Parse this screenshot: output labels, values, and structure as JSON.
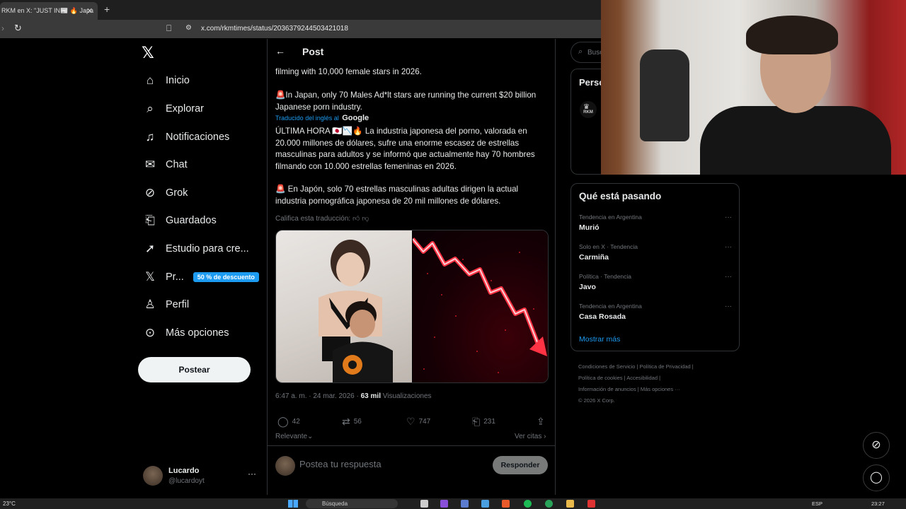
{
  "browser": {
    "tab_title": "RKM en X: \"JUST IN📰 🔥 Japa",
    "tab_close": "✕",
    "new_tab": "+",
    "url": "x.com/rkmtimes/status/2036379244503421018"
  },
  "nav": {
    "items": [
      {
        "label": "Inicio",
        "icon": "home-icon"
      },
      {
        "label": "Explorar",
        "icon": "search-icon"
      },
      {
        "label": "Notificaciones",
        "icon": "bell-icon"
      },
      {
        "label": "Chat",
        "icon": "mail-icon"
      },
      {
        "label": "Grok",
        "icon": "grok-icon"
      },
      {
        "label": "Guardados",
        "icon": "bookmark-icon"
      },
      {
        "label": "Estudio para cre...",
        "icon": "rocket-icon"
      },
      {
        "label": "Pr...",
        "icon": "x-premium-icon"
      },
      {
        "label": "Perfil",
        "icon": "person-icon"
      },
      {
        "label": "Más opciones",
        "icon": "more-circle-icon"
      }
    ],
    "premium_badge": "50 % de descuento",
    "post_button": "Postear"
  },
  "account": {
    "name": "Lucardo",
    "handle": "@lucardoyt",
    "more": "···"
  },
  "post": {
    "header_title": "Post",
    "text_en_1": "filming with 10,000 female stars in 2026.",
    "text_en_2": "🚨In Japan, only 70 Males Ad*lt stars are running the current $20 billion Japanese porn industry.",
    "translated_by": "Traducido del inglés al",
    "translated_brand": "Google",
    "text_es_1": "ÚLTIMA HORA 🇯🇵📉🔥 La industria japonesa del porno, valorada en 20.000 millones de dólares, sufre una enorme escasez de estrellas masculinas para adultos y se informó que actualmente hay 70 hombres filmando con 10.000 estrellas femeninas en 2026.",
    "text_es_2": "🚨 En Japón, solo 70 estrellas masculinas adultas dirigen la actual industria pornográfica japonesa de 20 mil millones de dólares.",
    "rate_translation": "Califica esta traducción:",
    "meta_time": "6:47 a. m. · 24 mar. 2026 · ",
    "meta_views": "63 mil",
    "meta_views_label": " Visualizaciones",
    "replies": "42",
    "reposts": "56",
    "likes": "747",
    "bookmarks": "231",
    "relevant": "Relevante",
    "quotes": "Ver citas",
    "reply_placeholder": "Postea tu respuesta",
    "reply_button": "Responder"
  },
  "sidebar": {
    "search_placeholder": "Busc",
    "persons_title": "Perso",
    "rkm_label": "RKM",
    "trends_title": "Qué está pasando",
    "trends": [
      {
        "context": "Tendencia en Argentina",
        "name": "Murió"
      },
      {
        "context": "Solo en X · Tendencia",
        "name": "Carmiña"
      },
      {
        "context": "Política · Tendencia",
        "name": "Javo"
      },
      {
        "context": "Tendencia en Argentina",
        "name": "Casa Rosada"
      }
    ],
    "trend_more": "···",
    "show_more": "Mostrar más",
    "footer": {
      "l1": "Condiciones de Servicio  |  Política de Privacidad  |",
      "l2": "Política de cookies  |  Accesibilidad  |",
      "l3": "Información de anuncios  |  Más opciones ···",
      "l4": "© 2026 X Corp."
    }
  },
  "taskbar": {
    "weather": "23°C",
    "search": "Búsqueda",
    "lang": "ESP",
    "time": "23:27"
  },
  "colors": {
    "accent": "#1d9bf0",
    "background": "#000000",
    "border": "#2f3336",
    "muted": "#71767b"
  }
}
